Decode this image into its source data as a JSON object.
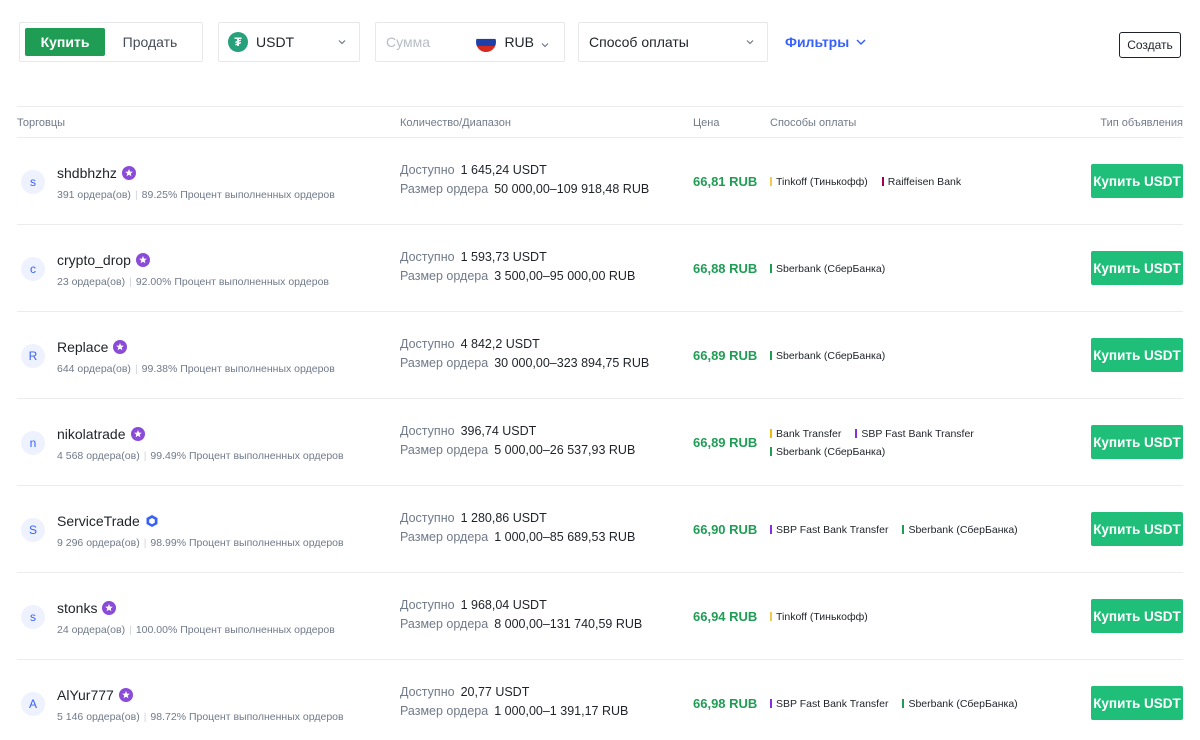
{
  "toolbar": {
    "buy_label": "Купить",
    "sell_label": "Продать",
    "coin": "USDT",
    "coin_icon": "tether-icon",
    "amount_placeholder": "Сумма",
    "fiat": "RUB",
    "payment_method": "Способ оплаты",
    "filters_label": "Фильтры",
    "create_label": "Создать"
  },
  "colors": {
    "buy_green": "#1f9d55",
    "button_green": "#1fbf7a",
    "link_blue": "#3861fb",
    "tinkoff": "#f2c94c",
    "raiffeisen": "#a0004e",
    "sberbank": "#1f9d55",
    "bank_transfer": "#f0b90b",
    "sbp": "#8a2be2"
  },
  "table": {
    "headers": {
      "traders": "Торговцы",
      "amount": "Количество/Диапазон",
      "price": "Цена",
      "payment": "Способы оплаты",
      "type": "Тип объявления"
    },
    "available_label": "Доступно",
    "limit_label": "Размер ордера",
    "rows": [
      {
        "initial": "s",
        "name": "shdbhzhz",
        "badge": "merchant-badge-icon",
        "orders": "391 ордера(ов)",
        "completion": "89.25% Процент выполненных ордеров",
        "available": "1 645,24 USDT",
        "limit": "50 000,00–109 918,48 RUB",
        "price": "66,81 RUB",
        "methods": [
          {
            "name": "Tinkoff (Тинькофф)",
            "color": "#f2c94c"
          },
          {
            "name": "Raiffeisen Bank",
            "color": "#a0004e"
          }
        ],
        "action": "Купить USDT"
      },
      {
        "initial": "c",
        "name": "crypto_drop",
        "badge": "merchant-badge-icon",
        "orders": "23 ордера(ов)",
        "completion": "92.00% Процент выполненных ордеров",
        "available": "1 593,73 USDT",
        "limit": "3 500,00–95 000,00 RUB",
        "price": "66,88 RUB",
        "methods": [
          {
            "name": "Sberbank (СберБанка)",
            "color": "#1f9d55"
          }
        ],
        "action": "Купить USDT"
      },
      {
        "initial": "R",
        "name": "Replace",
        "badge": "merchant-badge-icon",
        "orders": "644 ордера(ов)",
        "completion": "99.38% Процент выполненных ордеров",
        "available": "4 842,2 USDT",
        "limit": "30 000,00–323 894,75 RUB",
        "price": "66,89 RUB",
        "methods": [
          {
            "name": "Sberbank (СберБанка)",
            "color": "#1f9d55"
          }
        ],
        "action": "Купить USDT"
      },
      {
        "initial": "n",
        "name": "nikolatrade",
        "badge": "merchant-badge-icon",
        "orders": "4 568 ордера(ов)",
        "completion": "99.49% Процент выполненных ордеров",
        "available": "396,74 USDT",
        "limit": "5 000,00–26 537,93 RUB",
        "price": "66,89 RUB",
        "methods": [
          {
            "name": "Bank Transfer",
            "color": "#f0b90b"
          },
          {
            "name": "SBP Fast Bank Transfer",
            "color": "#8a2be2"
          },
          {
            "name": "Sberbank (СберБанка)",
            "color": "#1f9d55"
          }
        ],
        "action": "Купить USDT"
      },
      {
        "initial": "S",
        "name": "ServiceTrade",
        "badge": "verified-shield-icon",
        "orders": "9 296 ордера(ов)",
        "completion": "98.99% Процент выполненных ордеров",
        "available": "1 280,86 USDT",
        "limit": "1 000,00–85 689,53 RUB",
        "price": "66,90 RUB",
        "methods": [
          {
            "name": "SBP Fast Bank Transfer",
            "color": "#8a2be2"
          },
          {
            "name": "Sberbank (СберБанка)",
            "color": "#1f9d55"
          }
        ],
        "action": "Купить USDT"
      },
      {
        "initial": "s",
        "name": "stonks",
        "badge": "merchant-badge-icon",
        "orders": "24 ордера(ов)",
        "completion": "100.00% Процент выполненных ордеров",
        "available": "1 968,04 USDT",
        "limit": "8 000,00–131 740,59 RUB",
        "price": "66,94 RUB",
        "methods": [
          {
            "name": "Tinkoff (Тинькофф)",
            "color": "#f2c94c"
          }
        ],
        "action": "Купить USDT"
      },
      {
        "initial": "A",
        "name": "AlYur777",
        "badge": "merchant-badge-icon",
        "orders": "5 146 ордера(ов)",
        "completion": "98.72% Процент выполненных ордеров",
        "available": "20,77 USDT",
        "limit": "1 000,00–1 391,17 RUB",
        "price": "66,98 RUB",
        "methods": [
          {
            "name": "SBP Fast Bank Transfer",
            "color": "#8a2be2"
          },
          {
            "name": "Sberbank (СберБанка)",
            "color": "#1f9d55"
          }
        ],
        "action": "Купить USDT"
      }
    ]
  }
}
